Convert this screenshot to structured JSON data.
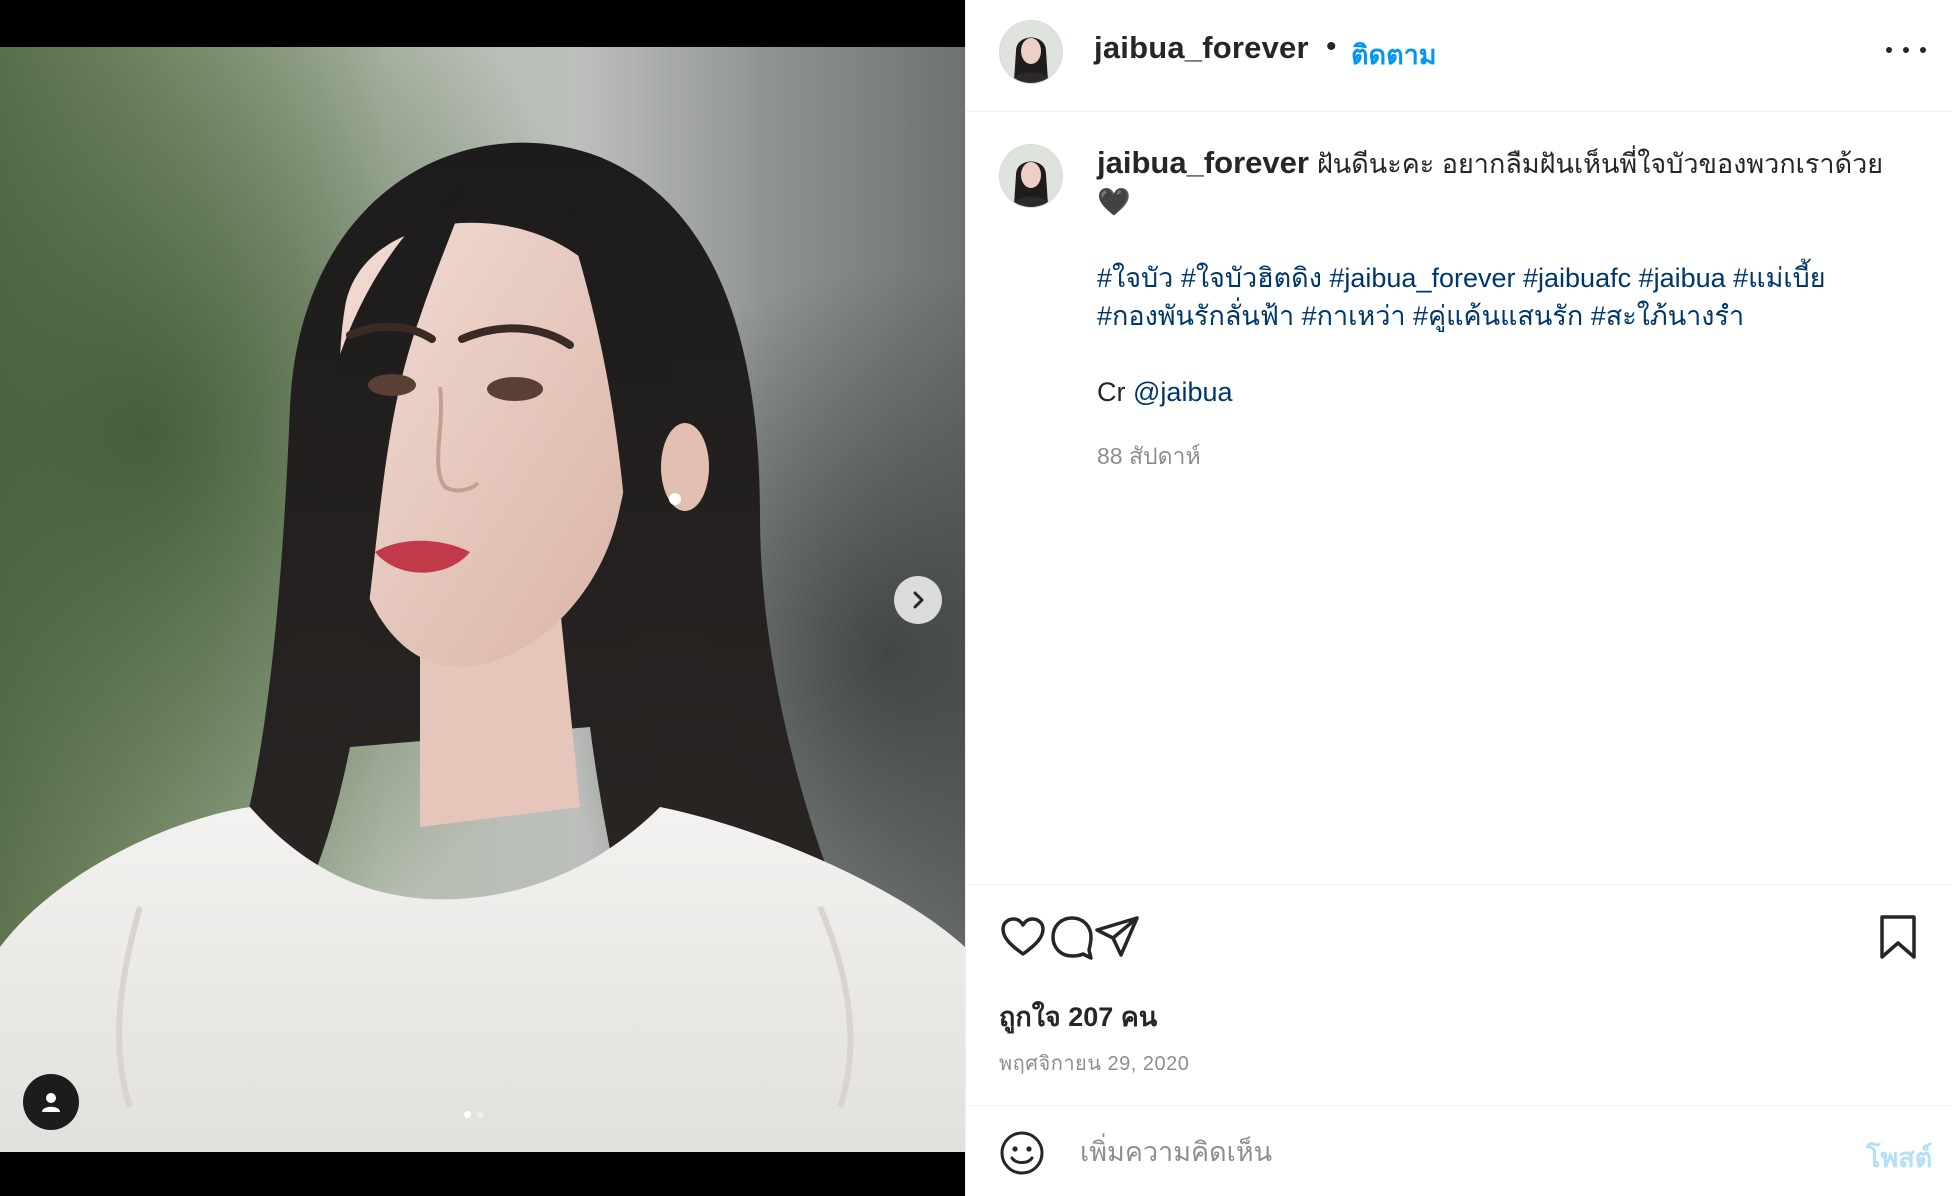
{
  "post": {
    "username": "jaibua_forever",
    "separator": "•",
    "follow_label": "ติดตาม",
    "more_icon": "more-horizontal-icon",
    "caption": {
      "username": "jaibua_forever",
      "text": "ฝันดีนะคะ อยากลืมฝันเห็นพี่ใจบัวของพวกเราด้วย",
      "emoji": "🖤",
      "hashtags_line1": "#ใจบัว #ใจบัวฮิตดิง #jaibua_forever #jaibuafc #jaibua #แม่เบี้ย",
      "hashtags_line2": "#กองพันรักลั่นฟ้า #กาเหว่า #คู่แค้นแสนรัก #สะใภ้นางรำ",
      "credit_prefix": "Cr",
      "credit_mention": "@jaibua",
      "time_ago": "88 สัปดาห์"
    },
    "actions": {
      "like_icon": "heart-icon",
      "comment_icon": "comment-icon",
      "share_icon": "share-icon",
      "save_icon": "bookmark-icon"
    },
    "likes_text": "ถูกใจ 207 คน",
    "date": "พฤศจิกายน 29, 2020",
    "comment": {
      "placeholder": "เพิ่มความคิดเห็น",
      "post_label": "โพสต์",
      "emoji_icon": "smiley-icon"
    },
    "carousel": {
      "next_icon": "chevron-right-icon",
      "tag_icon": "person-tag-icon",
      "slide_count": 2,
      "active_slide": 1
    },
    "colors": {
      "accent": "#0095f6",
      "link": "#00376b",
      "muted": "#8e8e8e",
      "post_disabled": "#b2dffc"
    }
  }
}
